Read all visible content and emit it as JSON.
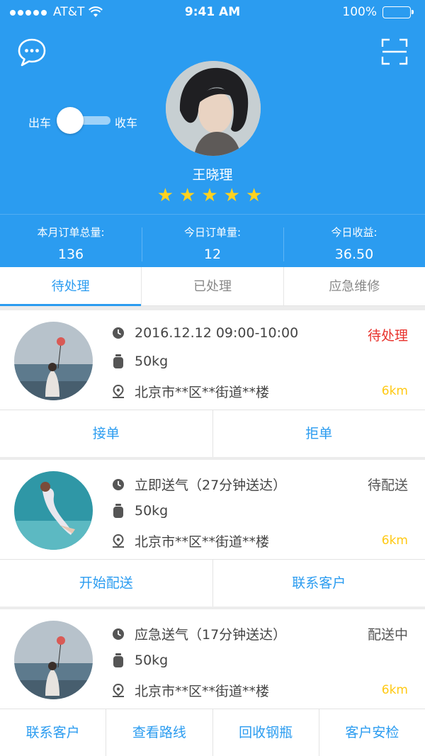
{
  "status_bar": {
    "carrier": "AT&T",
    "time": "9:41 AM",
    "battery": "100%"
  },
  "header": {
    "toggle_left": "出车",
    "toggle_right": "收车",
    "name": "王晓理",
    "rating": 5,
    "stars": "★★★★★"
  },
  "stats": [
    {
      "label": "本月订单总量:",
      "value": "136"
    },
    {
      "label": "今日订单量:",
      "value": "12"
    },
    {
      "label": "今日收益:",
      "value": "36.50"
    }
  ],
  "tabs": [
    {
      "label": "待处理",
      "active": true
    },
    {
      "label": "已处理",
      "active": false
    },
    {
      "label": "应急维修",
      "active": false
    }
  ],
  "orders": [
    {
      "time": "2016.12.12  09:00-10:00",
      "weight": "50kg",
      "address": "北京市**区**街道**楼",
      "status": "待处理",
      "distance": "6km",
      "actions": [
        "接单",
        "拒单"
      ]
    },
    {
      "time": "立即送气（27分钟送达）",
      "weight": "50kg",
      "address": "北京市**区**街道**楼",
      "status": "待配送",
      "distance": "6km",
      "actions": [
        "开始配送",
        "联系客户"
      ]
    },
    {
      "time": "应急送气（17分钟送达）",
      "weight": "50kg",
      "address": "北京市**区**街道**楼",
      "status": "配送中",
      "distance": "6km",
      "actions": [
        "联系客户",
        "查看路线",
        "回收钢瓶",
        "客户安检"
      ]
    }
  ],
  "colors": {
    "primary": "#2b9cf0",
    "star": "#ffd21f",
    "pending_red": "#e8322c",
    "distance": "#ffc913"
  }
}
